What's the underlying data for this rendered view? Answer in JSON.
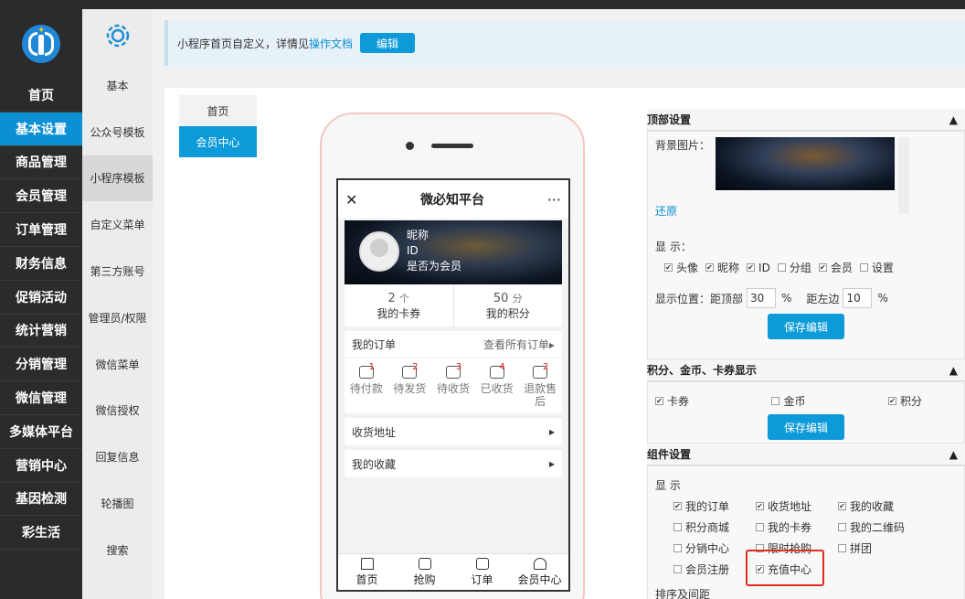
{
  "sidebar": {
    "items": [
      {
        "label": "首页"
      },
      {
        "label": "基本设置"
      },
      {
        "label": "商品管理"
      },
      {
        "label": "会员管理"
      },
      {
        "label": "订单管理"
      },
      {
        "label": "财务信息"
      },
      {
        "label": "促销活动"
      },
      {
        "label": "统计营销"
      },
      {
        "label": "分销管理"
      },
      {
        "label": "微信管理"
      },
      {
        "label": "多媒体平台"
      },
      {
        "label": "营销中心"
      },
      {
        "label": "基因检测"
      },
      {
        "label": "彩生活"
      }
    ],
    "active_index": 1
  },
  "subbar": {
    "items": [
      {
        "label": "基本"
      },
      {
        "label": "公众号模板"
      },
      {
        "label": "小程序模板"
      },
      {
        "label": "自定义菜单"
      },
      {
        "label": "第三方账号"
      },
      {
        "label": "管理员/权限"
      },
      {
        "label": "微信菜单"
      },
      {
        "label": "微信授权"
      },
      {
        "label": "回复信息"
      },
      {
        "label": "轮播图"
      },
      {
        "label": "搜索"
      }
    ],
    "active_index": 2
  },
  "notice": {
    "text": "小程序首页自定义，详情见",
    "link": "操作文档",
    "button": "编辑"
  },
  "tabs": [
    {
      "label": "首页"
    },
    {
      "label": "会员中心"
    }
  ],
  "phone": {
    "title": "微必知平台",
    "close": "✕",
    "more": "···",
    "profile": {
      "nickname": "昵称",
      "id": "ID",
      "member": "是否为会员"
    },
    "stats": [
      {
        "num": "2",
        "unit": "个",
        "label": "我的卡券"
      },
      {
        "num": "50",
        "unit": "分",
        "label": "我的积分"
      }
    ],
    "orders": {
      "title": "我的订单",
      "link": "查看所有订单▸",
      "icons": [
        {
          "label": "待付款",
          "badge": "1"
        },
        {
          "label": "待发货",
          "badge": "2"
        },
        {
          "label": "待收货",
          "badge": "3"
        },
        {
          "label": "已收货",
          "badge": "4"
        },
        {
          "label": "退款售后",
          "badge": "2"
        }
      ]
    },
    "menu": [
      {
        "label": "收货地址",
        "arrow": "▸"
      },
      {
        "label": "我的收藏",
        "arrow": "▸"
      }
    ],
    "tabbar": [
      {
        "label": "首页"
      },
      {
        "label": "抢购"
      },
      {
        "label": "订单"
      },
      {
        "label": "会员中心"
      }
    ]
  },
  "config": {
    "top": {
      "title": "顶部设置",
      "toggle": "▲",
      "bg_label": "背景图片：",
      "restore": "还原",
      "display_label": "显 示：",
      "options": [
        {
          "label": "头像",
          "checked": true
        },
        {
          "label": "昵称",
          "checked": true
        },
        {
          "label": "ID",
          "checked": true
        },
        {
          "label": "分组",
          "checked": false
        },
        {
          "label": "会员",
          "checked": true
        },
        {
          "label": "设置",
          "checked": false
        }
      ],
      "pos_label": "显示位置：",
      "top_label": "距顶部",
      "top_value": "30",
      "left_label": "距左边",
      "left_value": "10",
      "percent": "%",
      "save": "保存编辑"
    },
    "points": {
      "title": "积分、金币、卡券显示",
      "toggle": "▲",
      "options": [
        {
          "label": "卡券",
          "checked": true
        },
        {
          "label": "金币",
          "checked": false
        },
        {
          "label": "积分",
          "checked": true
        }
      ],
      "save": "保存编辑"
    },
    "components": {
      "title": "组件设置",
      "toggle": "▲",
      "display_label": "显 示",
      "options": [
        {
          "label": "我的订单",
          "checked": true
        },
        {
          "label": "收货地址",
          "checked": true
        },
        {
          "label": "我的收藏",
          "checked": true
        },
        {
          "label": "积分商城",
          "checked": false
        },
        {
          "label": "我的卡券",
          "checked": false
        },
        {
          "label": "我的二维码",
          "checked": false
        },
        {
          "label": "分销中心",
          "checked": false
        },
        {
          "label": "限时抢购",
          "checked": false
        },
        {
          "label": "拼团",
          "checked": false
        },
        {
          "label": "会员注册",
          "checked": false
        },
        {
          "label": "充值中心",
          "checked": true
        }
      ],
      "sort_label": "排序及间距"
    }
  }
}
